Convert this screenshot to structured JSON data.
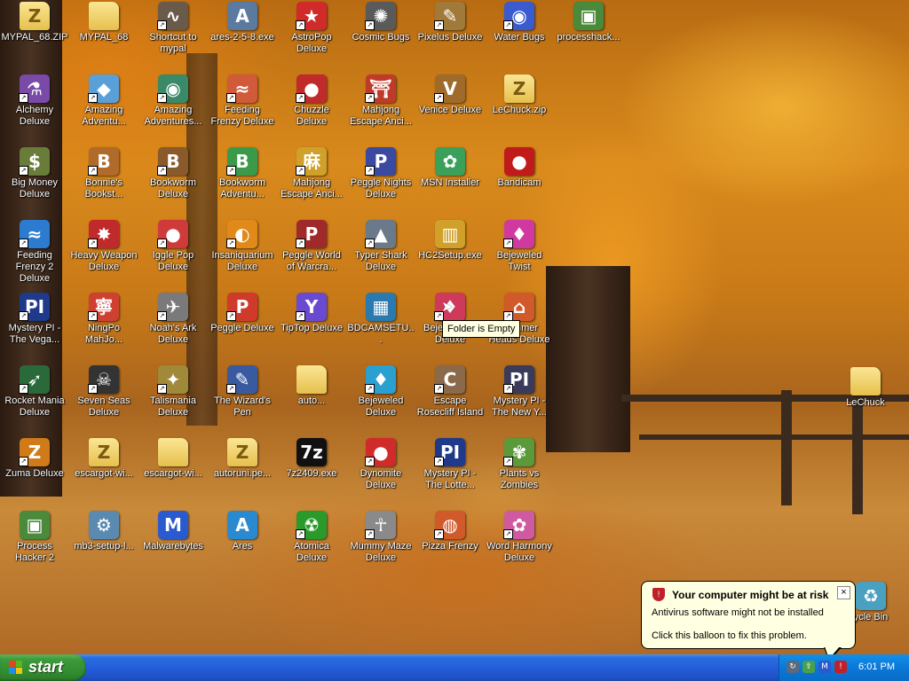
{
  "desktop": {
    "icons": [
      {
        "label": "MYPAL_68.ZIP",
        "glyph": "Z",
        "color": "#e8c24a",
        "folder": true,
        "shortcut": false
      },
      {
        "label": "Alchemy Deluxe",
        "glyph": "⚗",
        "color": "#7a4aa8",
        "shortcut": true
      },
      {
        "label": "Big Money Deluxe",
        "glyph": "$",
        "color": "#6a7c3a",
        "shortcut": true
      },
      {
        "label": "Feeding Frenzy 2 Deluxe",
        "glyph": "≈",
        "color": "#2c7bd0",
        "shortcut": true
      },
      {
        "label": "Mystery PI - The Vega...",
        "glyph": "PI",
        "color": "#1f3a8a",
        "shortcut": true
      },
      {
        "label": "Rocket Mania Deluxe",
        "glyph": "➶",
        "color": "#2a6a3a",
        "shortcut": true
      },
      {
        "label": "Zuma Deluxe",
        "glyph": "Z",
        "color": "#d07a1a",
        "shortcut": true
      },
      {
        "label": "Process Hacker 2",
        "glyph": "▣",
        "color": "#4a8a3a",
        "shortcut": false
      },
      {
        "label": "MYPAL_68",
        "glyph": "",
        "color": "#e8c24a",
        "folder": true,
        "shortcut": false
      },
      {
        "label": "Amazing Adventu...",
        "glyph": "◆",
        "color": "#5aa0d8",
        "shortcut": true
      },
      {
        "label": "Bonnie's Bookst...",
        "glyph": "B",
        "color": "#b06a2a",
        "shortcut": true
      },
      {
        "label": "Heavy Weapon Deluxe",
        "glyph": "✸",
        "color": "#c02a2a",
        "shortcut": true
      },
      {
        "label": "NingPo MahJo...",
        "glyph": "寧",
        "color": "#d04030",
        "shortcut": true
      },
      {
        "label": "Seven Seas Deluxe",
        "glyph": "☠",
        "color": "#333333",
        "shortcut": true
      },
      {
        "label": "escargot-wi...",
        "glyph": "Z",
        "color": "#e8c24a",
        "folder": true,
        "shortcut": false
      },
      {
        "label": "mb3-setup-l...",
        "glyph": "⚙",
        "color": "#5a8ab0",
        "shortcut": false
      },
      {
        "label": "Shortcut to mypal",
        "glyph": "∿",
        "color": "#6a5a4a",
        "shortcut": true
      },
      {
        "label": "Amazing Adventures...",
        "glyph": "◉",
        "color": "#3a8a6a",
        "shortcut": true
      },
      {
        "label": "Bookworm Deluxe",
        "glyph": "B",
        "color": "#8a5a2a",
        "shortcut": true
      },
      {
        "label": "Iggle Pop Deluxe",
        "glyph": "●",
        "color": "#d03a3a",
        "shortcut": true
      },
      {
        "label": "Noah's Ark Deluxe",
        "glyph": "✈",
        "color": "#7a7a7a",
        "shortcut": true
      },
      {
        "label": "Talismania Deluxe",
        "glyph": "✦",
        "color": "#a08a3a",
        "shortcut": true
      },
      {
        "label": "escargot-wi...",
        "glyph": "",
        "color": "#e8c24a",
        "folder": true,
        "shortcut": false
      },
      {
        "label": "Malwarebytes",
        "glyph": "M",
        "color": "#2a5ad0",
        "shortcut": false
      },
      {
        "label": "ares-2-5-8.exe",
        "glyph": "A",
        "color": "#5a7aa0",
        "shortcut": false
      },
      {
        "label": "Feeding Frenzy Deluxe",
        "glyph": "≈",
        "color": "#d05a3a",
        "shortcut": true
      },
      {
        "label": "Bookworm Adventu...",
        "glyph": "B",
        "color": "#3a9a4a",
        "shortcut": true
      },
      {
        "label": "Insaniquarium Deluxe",
        "glyph": "◐",
        "color": "#e08a1a",
        "shortcut": true
      },
      {
        "label": "Peggle Deluxe",
        "glyph": "P",
        "color": "#d03a2a",
        "shortcut": true
      },
      {
        "label": "The Wizard's Pen",
        "glyph": "✎",
        "color": "#3a5aa0",
        "shortcut": true
      },
      {
        "label": "autoruni.pe...",
        "glyph": "Z",
        "color": "#e8c24a",
        "folder": true,
        "shortcut": false
      },
      {
        "label": "Ares",
        "glyph": "A",
        "color": "#2a8ad0",
        "shortcut": false
      },
      {
        "label": "AstroPop Deluxe",
        "glyph": "★",
        "color": "#d02a2a",
        "shortcut": true
      },
      {
        "label": "Chuzzle Deluxe",
        "glyph": "●",
        "color": "#c02a2a",
        "shortcut": true
      },
      {
        "label": "Mahjong Escape Anci...",
        "glyph": "麻",
        "color": "#d0a02a",
        "shortcut": true
      },
      {
        "label": "Peggle World of Warcra...",
        "glyph": "P",
        "color": "#a02a2a",
        "shortcut": true
      },
      {
        "label": "TipTop Deluxe",
        "glyph": "Y",
        "color": "#6a4ad0",
        "shortcut": true
      },
      {
        "label": "auto...",
        "glyph": "",
        "color": "#e8c24a",
        "folder": true,
        "shortcut": false
      },
      {
        "label": "7z2409.exe",
        "glyph": "7z",
        "color": "#111111",
        "shortcut": false
      },
      {
        "label": "Atomica Deluxe",
        "glyph": "☢",
        "color": "#2a9a2a",
        "shortcut": true
      },
      {
        "label": "Cosmic Bugs",
        "glyph": "✺",
        "color": "#5a5a5a",
        "shortcut": true
      },
      {
        "label": "Mahjong Escape Anci...",
        "glyph": "⛩",
        "color": "#c03a2a",
        "shortcut": true
      },
      {
        "label": "Peggle Nights Deluxe",
        "glyph": "P",
        "color": "#3a4aa0",
        "shortcut": true
      },
      {
        "label": "Typer Shark Deluxe",
        "glyph": "▲",
        "color": "#6a7a8a",
        "shortcut": true
      },
      {
        "label": "BDCAMSETU...",
        "glyph": "▦",
        "color": "#2a7ab0",
        "shortcut": false
      },
      {
        "label": "Bejeweled Deluxe",
        "glyph": "♦",
        "color": "#2aa0d0",
        "shortcut": true
      },
      {
        "label": "Dynomite Deluxe",
        "glyph": "●",
        "color": "#d02a2a",
        "shortcut": true
      },
      {
        "label": "Mummy Maze Deluxe",
        "glyph": "☥",
        "color": "#8a8a8a",
        "shortcut": true
      },
      {
        "label": "Pixelus Deluxe",
        "glyph": "✎",
        "color": "#a07a3a",
        "shortcut": true
      },
      {
        "label": "Venice Deluxe",
        "glyph": "V",
        "color": "#a06a2a",
        "shortcut": true
      },
      {
        "label": "MSN Installer",
        "glyph": "✿",
        "color": "#3aa05a",
        "shortcut": false
      },
      {
        "label": "HC2Setup.exe",
        "glyph": "▥",
        "color": "#d0a02a",
        "shortcut": false
      },
      {
        "label": "Bejeweled 2 Deluxe",
        "glyph": "♦",
        "color": "#d03a5a",
        "shortcut": true
      },
      {
        "label": "Escape Rosecliff Island",
        "glyph": "C",
        "color": "#8a6a4a",
        "shortcut": true
      },
      {
        "label": "Mystery PI - The Lotte...",
        "glyph": "PI",
        "color": "#1f3a8a",
        "shortcut": true
      },
      {
        "label": "Pizza Frenzy",
        "glyph": "◍",
        "color": "#d05a2a",
        "shortcut": true
      },
      {
        "label": "Water Bugs",
        "glyph": "◉",
        "color": "#3a5ad0",
        "shortcut": true
      },
      {
        "label": "LeChuck.zip",
        "glyph": "Z",
        "color": "#e8c24a",
        "folder": true,
        "shortcut": false
      },
      {
        "label": "Bandicam",
        "glyph": "●",
        "color": "#c01a1a",
        "shortcut": false
      },
      {
        "label": "Bejeweled Twist",
        "glyph": "♦",
        "color": "#d03aa0",
        "shortcut": true
      },
      {
        "label": "Hammer Heads Deluxe",
        "glyph": "⌂",
        "color": "#d05a2a",
        "shortcut": true
      },
      {
        "label": "Mystery PI - The New Y...",
        "glyph": "PI",
        "color": "#3a3a5a",
        "shortcut": true
      },
      {
        "label": "Plants vs Zombies",
        "glyph": "✾",
        "color": "#5a9a3a",
        "shortcut": true
      },
      {
        "label": "Word Harmony Deluxe",
        "glyph": "✿",
        "color": "#d05aa0",
        "shortcut": true
      },
      {
        "label": "processhack...",
        "glyph": "▣",
        "color": "#4a8a3a",
        "shortcut": false
      },
      {
        "label": "LeChuck",
        "glyph": "",
        "color": "#e8c24a",
        "folder": true,
        "shortcut": false
      }
    ],
    "tooltip": "Folder is Empty",
    "recycle_label": "ycle Bin"
  },
  "balloon": {
    "title": "Your computer might be at risk",
    "line1": "Antivirus software might not be installed",
    "line2": "Click this balloon to fix this problem.",
    "close": "×"
  },
  "taskbar": {
    "start_label": "start",
    "clock": "6:01 PM",
    "colors": {
      "taskbar": "#245edb",
      "start": "#3c9b3a",
      "tray": "#0b77d8"
    }
  }
}
